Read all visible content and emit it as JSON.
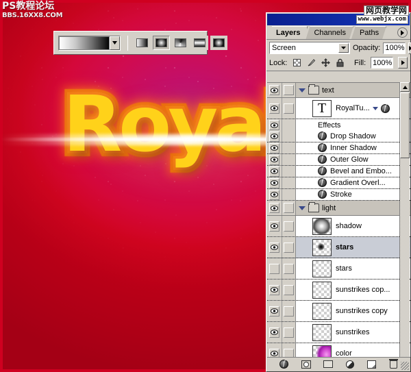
{
  "artwork": {
    "wordmark": "Royal",
    "watermark_top_left": {
      "cn": "PS教程论坛",
      "en": "BBS.16XX8.COM"
    },
    "watermark_top_right": {
      "cn": "网页教学网",
      "en": "www.webjx.com"
    },
    "background_colors": {
      "magenta": "#b0157a",
      "crimson": "#cf0c52",
      "red": "#cf0020",
      "text_fill": "#ffd21a",
      "text_stroke": "#f07d12"
    }
  },
  "gradient_bar": {
    "name": "gradient-options-bar",
    "preset_label": "",
    "dropdown_icon": "chevron-down-icon",
    "types": [
      {
        "name": "linear-gradient",
        "selected": false
      },
      {
        "name": "radial-gradient",
        "selected": true
      },
      {
        "name": "angle-gradient",
        "selected": false
      },
      {
        "name": "reflected-gradient",
        "selected": false
      },
      {
        "name": "diamond-gradient",
        "selected": false
      }
    ]
  },
  "palette": {
    "tabs": [
      {
        "label": "Layers",
        "active": true
      },
      {
        "label": "Channels",
        "active": false
      },
      {
        "label": "Paths",
        "active": false
      }
    ],
    "menu_icon": "chevron-right-icon",
    "blend_mode": "Screen",
    "opacity_label": "Opacity:",
    "opacity_value": "100%",
    "lock_label": "Lock:",
    "fill_label": "Fill:",
    "fill_value": "100%",
    "lock_icons": [
      "transparency-lock-icon",
      "brush-lock-icon",
      "move-lock-icon",
      "all-lock-icon"
    ],
    "rows": [
      {
        "kind": "group",
        "name": "text",
        "eye": true,
        "link": true,
        "expanded": true,
        "thumb": "folder"
      },
      {
        "kind": "layer",
        "name": "RoyalTu...",
        "eye": true,
        "link": true,
        "thumb": "type",
        "has_fx": true,
        "selected": false
      },
      {
        "kind": "effects",
        "name": "Effects",
        "eye": true
      },
      {
        "kind": "fx",
        "name": "Drop Shadow",
        "eye": true
      },
      {
        "kind": "fx",
        "name": "Inner Shadow",
        "eye": true
      },
      {
        "kind": "fx",
        "name": "Outer Glow",
        "eye": true
      },
      {
        "kind": "fx",
        "name": "Bevel and Embo...",
        "eye": true
      },
      {
        "kind": "fx",
        "name": "Gradient Overl...",
        "eye": true
      },
      {
        "kind": "fx",
        "name": "Stroke",
        "eye": true
      },
      {
        "kind": "group",
        "name": "light",
        "eye": true,
        "link": true,
        "expanded": true,
        "thumb": "folder"
      },
      {
        "kind": "layer",
        "name": "shadow",
        "eye": true,
        "link": true,
        "thumb": "shadow",
        "selected": false
      },
      {
        "kind": "layer",
        "name": "stars",
        "eye": true,
        "link": true,
        "thumb": "stars",
        "selected": true
      },
      {
        "kind": "layer",
        "name": "stars",
        "eye": false,
        "link": false,
        "thumb": "empty",
        "selected": false
      },
      {
        "kind": "layer",
        "name": "sunstrikes cop...",
        "eye": true,
        "link": true,
        "thumb": "empty",
        "selected": false
      },
      {
        "kind": "layer",
        "name": "sunstrikes copy",
        "eye": true,
        "link": true,
        "thumb": "empty",
        "selected": false
      },
      {
        "kind": "layer",
        "name": "sunstrikes",
        "eye": true,
        "link": true,
        "thumb": "empty",
        "selected": false
      },
      {
        "kind": "layer",
        "name": "color",
        "eye": true,
        "link": true,
        "thumb": "color",
        "selected": false
      }
    ],
    "bottom_buttons": [
      {
        "name": "layer-style-button",
        "icon": "fx-icon"
      },
      {
        "name": "layer-mask-button",
        "icon": "mask-icon"
      },
      {
        "name": "new-group-button",
        "icon": "folder-icon"
      },
      {
        "name": "adjustment-layer-button",
        "icon": "half-circle-icon"
      },
      {
        "name": "new-layer-button",
        "icon": "new-page-icon"
      },
      {
        "name": "delete-layer-button",
        "icon": "trash-icon"
      }
    ],
    "scrollbar": {
      "up": "▲",
      "down": "▼"
    }
  }
}
